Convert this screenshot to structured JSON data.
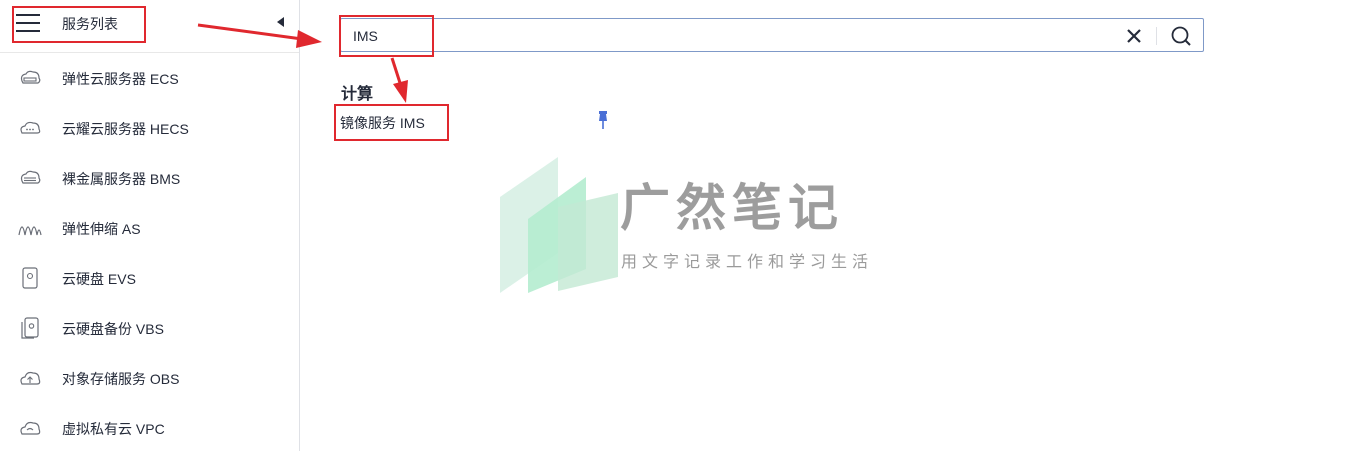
{
  "sidebar": {
    "title": "服务列表",
    "items": [
      {
        "label": "弹性云服务器 ECS",
        "icon": "ecs-icon"
      },
      {
        "label": "云耀云服务器 HECS",
        "icon": "hecs-cloud-icon"
      },
      {
        "label": "裸金属服务器 BMS",
        "icon": "bms-icon"
      },
      {
        "label": "弹性伸缩 AS",
        "icon": "autoscaling-icon"
      },
      {
        "label": "云硬盘 EVS",
        "icon": "evs-disk-icon"
      },
      {
        "label": "云硬盘备份 VBS",
        "icon": "vbs-backup-icon"
      },
      {
        "label": "对象存储服务 OBS",
        "icon": "obs-cloud-icon"
      },
      {
        "label": "虚拟私有云 VPC",
        "icon": "vpc-cloud-icon"
      }
    ]
  },
  "search": {
    "value": "IMS",
    "placeholder": ""
  },
  "results": {
    "category": "计算",
    "items": [
      {
        "label": "镜像服务 IMS",
        "pinned": false
      }
    ]
  },
  "watermark": {
    "title": "广然笔记",
    "subtitle": "用文字记录工作和学习生活"
  },
  "colors": {
    "annotation_red": "#e0282e",
    "search_border": "#7f99c8",
    "pin_blue": "#4a6fd6",
    "text": "#252b3a"
  }
}
